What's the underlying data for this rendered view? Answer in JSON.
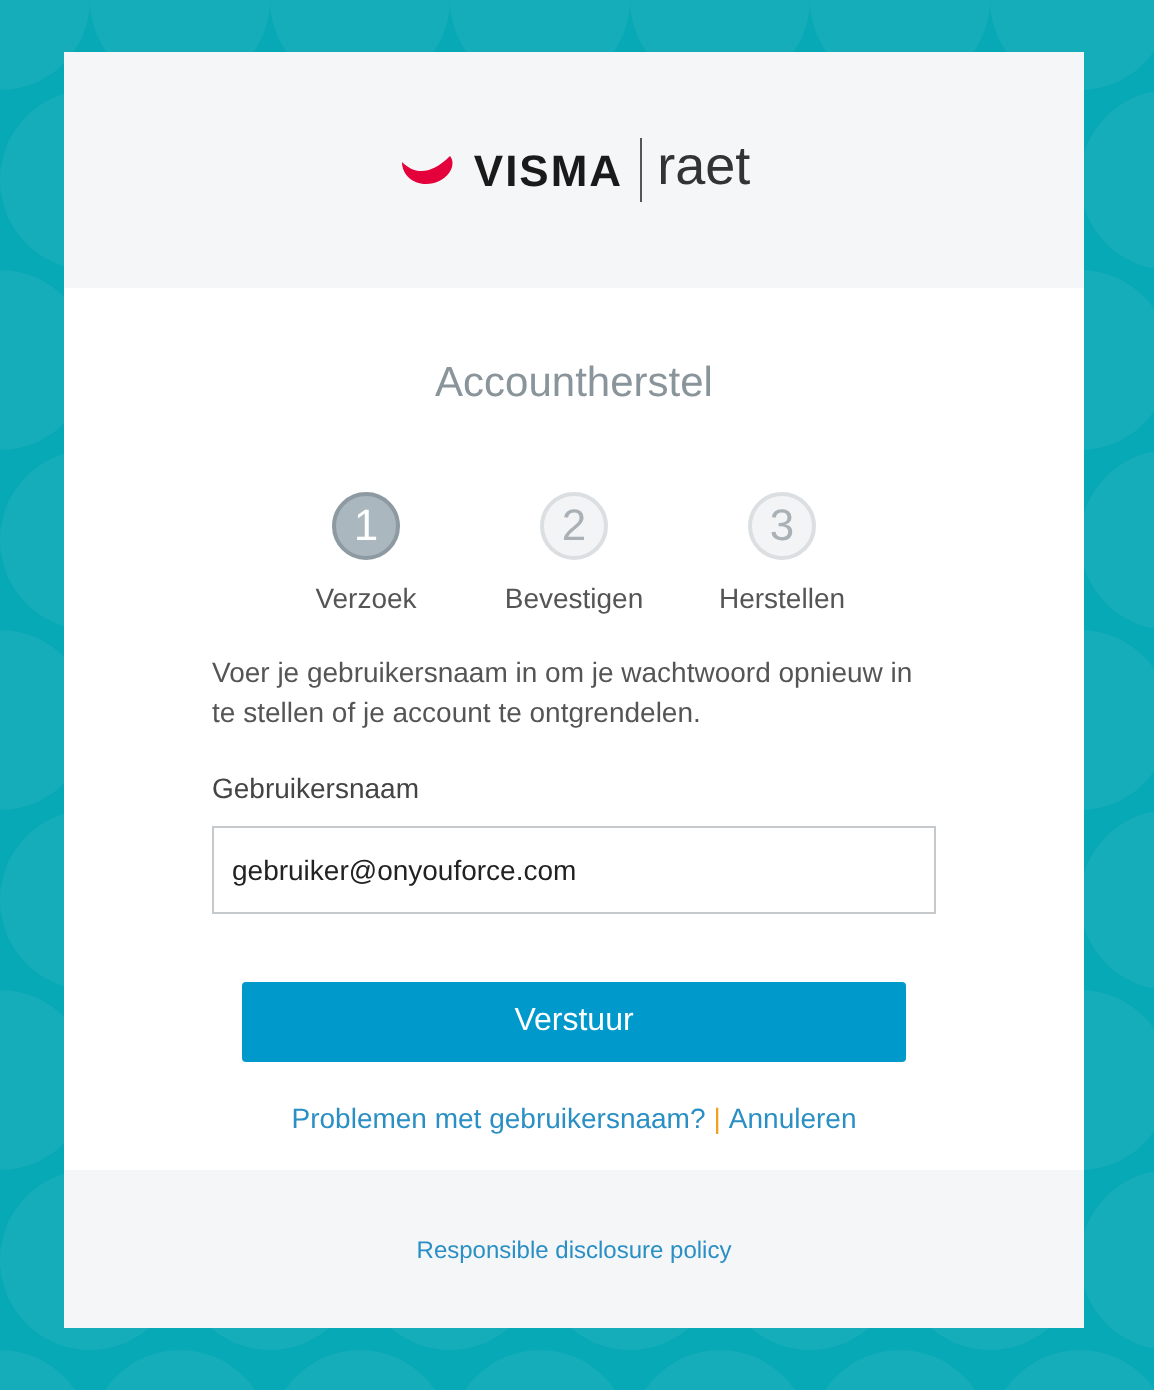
{
  "logo": {
    "brand": "VISMA",
    "product": "raet"
  },
  "title": "Accountherstel",
  "steps": [
    {
      "number": "1",
      "label": "Verzoek",
      "selected": true
    },
    {
      "number": "2",
      "label": "Bevestigen",
      "selected": false
    },
    {
      "number": "3",
      "label": "Herstellen",
      "selected": false
    }
  ],
  "instructions": "Voer je gebruikersnaam in om je wachtwoord opnieuw in te stellen of je account te ontgrendelen.",
  "username_field": {
    "label": "Gebruikersnaam",
    "value": "gebruiker@onyouforce.com"
  },
  "submit_button": "Verstuur",
  "links": {
    "problems": "Problemen met gebruikersnaam?",
    "separator": "|",
    "cancel": "Annuleren"
  },
  "footer_link": "Responsible disclosure policy"
}
